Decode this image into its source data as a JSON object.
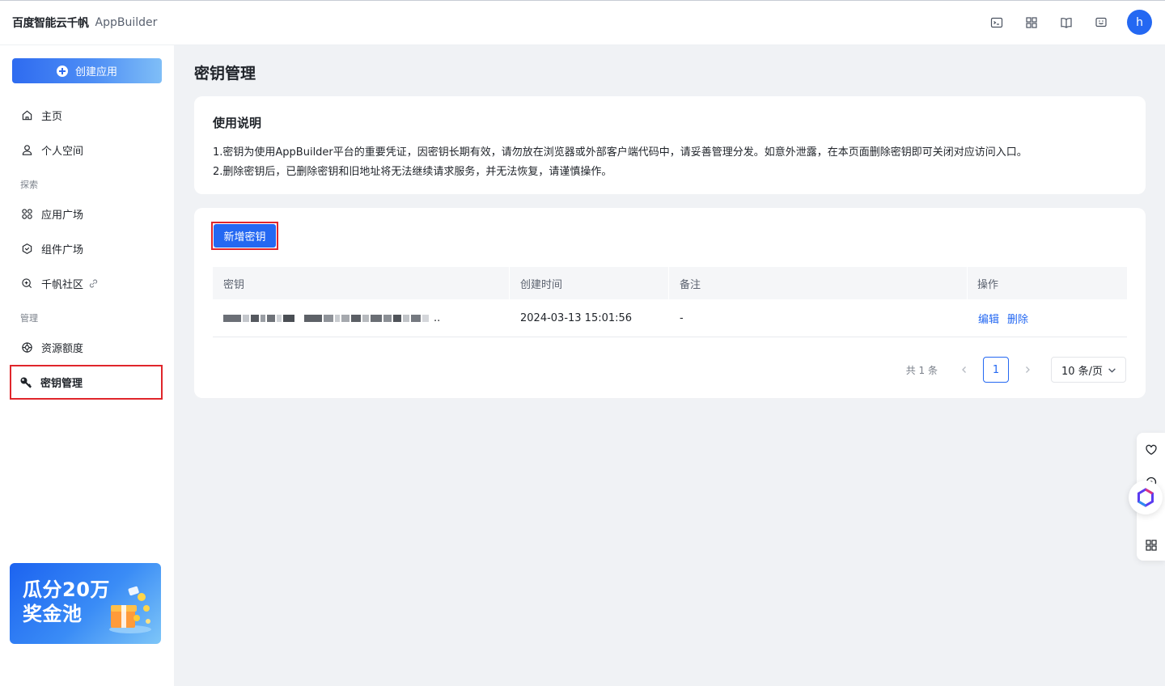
{
  "header": {
    "brand_cn": "百度智能云千帆",
    "brand_en": "AppBuilder",
    "user_initial": "h",
    "accent": "#2468f2"
  },
  "sidebar": {
    "create_label": "创建应用",
    "items": [
      {
        "label": "主页",
        "icon": "home-icon"
      },
      {
        "label": "个人空间",
        "icon": "user-icon"
      },
      {
        "label": "应用广场",
        "icon": "apps-icon"
      },
      {
        "label": "组件广场",
        "icon": "component-icon"
      },
      {
        "label": "千帆社区",
        "icon": "community-icon"
      },
      {
        "label": "资源额度",
        "icon": "quota-icon"
      },
      {
        "label": "密钥管理",
        "icon": "key-icon"
      }
    ],
    "sections": [
      "探索",
      "管理"
    ],
    "promo": {
      "line1": "瓜分20万",
      "line2": "奖金池"
    }
  },
  "main": {
    "title": "密钥管理",
    "notice": {
      "title": "使用说明",
      "line1": "1.密钥为使用AppBuilder平台的重要凭证，因密钥长期有效，请勿放在浏览器或外部客户端代码中，请妥善管理分发。如意外泄露，在本页面删除密钥即可关闭对应访问入口。",
      "line2": "2.删除密钥后，已删除密钥和旧地址将无法继续请求服务，并无法恢复，请谨慎操作。"
    },
    "add_key_label": "新增密钥",
    "table": {
      "columns": [
        "密钥",
        "创建时间",
        "备注",
        "操作"
      ],
      "rows": [
        {
          "key_suffix": "..",
          "created": "2024-03-13 15:01:56",
          "note": "-",
          "edit": "编辑",
          "delete": "删除"
        }
      ]
    },
    "pagination": {
      "total": "共 1 条",
      "current_page": "1",
      "page_size": "10 条/页"
    }
  }
}
